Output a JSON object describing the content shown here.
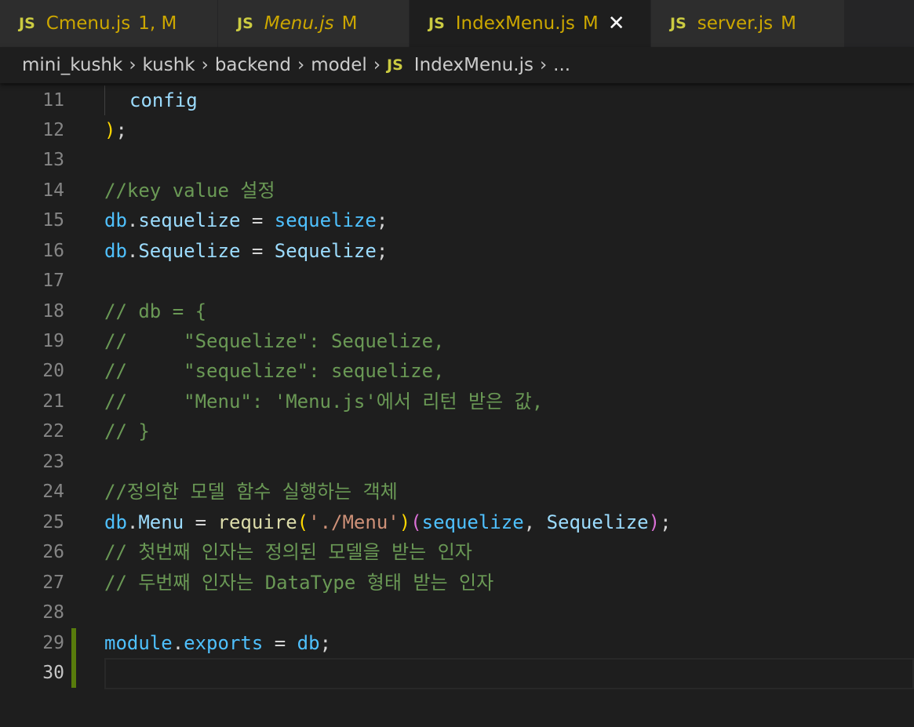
{
  "tabs": [
    {
      "js": "JS",
      "name": "Cmenu.js",
      "status": "1, M",
      "italic": false,
      "active": false
    },
    {
      "js": "JS",
      "name": "Menu.js",
      "status": "M",
      "italic": true,
      "active": false
    },
    {
      "js": "JS",
      "name": "IndexMenu.js",
      "status": "M",
      "italic": false,
      "active": true,
      "close": "✕"
    },
    {
      "js": "JS",
      "name": "server.js",
      "status": "M",
      "italic": false,
      "active": false
    }
  ],
  "breadcrumb": {
    "items": [
      "mini_kushk",
      "kushk",
      "backend",
      "model"
    ],
    "file_icon": "JS",
    "file": "IndexMenu.js",
    "more": "...",
    "separator": "›"
  },
  "editor": {
    "line_numbers": [
      "11",
      "12",
      "13",
      "14",
      "15",
      "16",
      "17",
      "18",
      "19",
      "20",
      "21",
      "22",
      "23",
      "24",
      "25",
      "26",
      "27",
      "28",
      "29",
      "30"
    ],
    "lines": {
      "l11": "config",
      "l12": [
        ")",
        ";"
      ],
      "l14": "//key value 설정",
      "l15": [
        "db",
        ".",
        "sequelize",
        " = ",
        "sequelize",
        ";"
      ],
      "l16": [
        "db",
        ".",
        "Sequelize",
        " = ",
        "Sequelize",
        ";"
      ],
      "l18": "// db = {",
      "l19": "//     \"Sequelize\": Sequelize,",
      "l20": "//     \"sequelize\": sequelize,",
      "l21": "//     \"Menu\": 'Menu.js'에서 리턴 받은 값,",
      "l22": "// }",
      "l24": "//정의한 모델 함수 실행하는 객체",
      "l25": [
        "db",
        ".",
        "Menu",
        " = ",
        "require",
        "(",
        "'./Menu'",
        ")",
        "(",
        "sequelize",
        ", ",
        "Sequelize",
        ")",
        ";"
      ],
      "l26": "// 첫번째 인자는 정의된 모델을 받는 인자",
      "l27": "// 두번째 인자는 DataType 형태 받는 인자",
      "l29": [
        "module",
        ".",
        "exports",
        " = ",
        "db",
        ";"
      ]
    }
  },
  "colors": {
    "background": "#1e1e1e",
    "comment": "#6a9955",
    "variable": "#4fc1ff",
    "property": "#9cdcfe",
    "function": "#dcdcaa",
    "string": "#ce9178",
    "bracket": "#ffd700",
    "bracket_nested": "#da70d6",
    "modified": "#cca700",
    "git_added": "#587c0c"
  }
}
